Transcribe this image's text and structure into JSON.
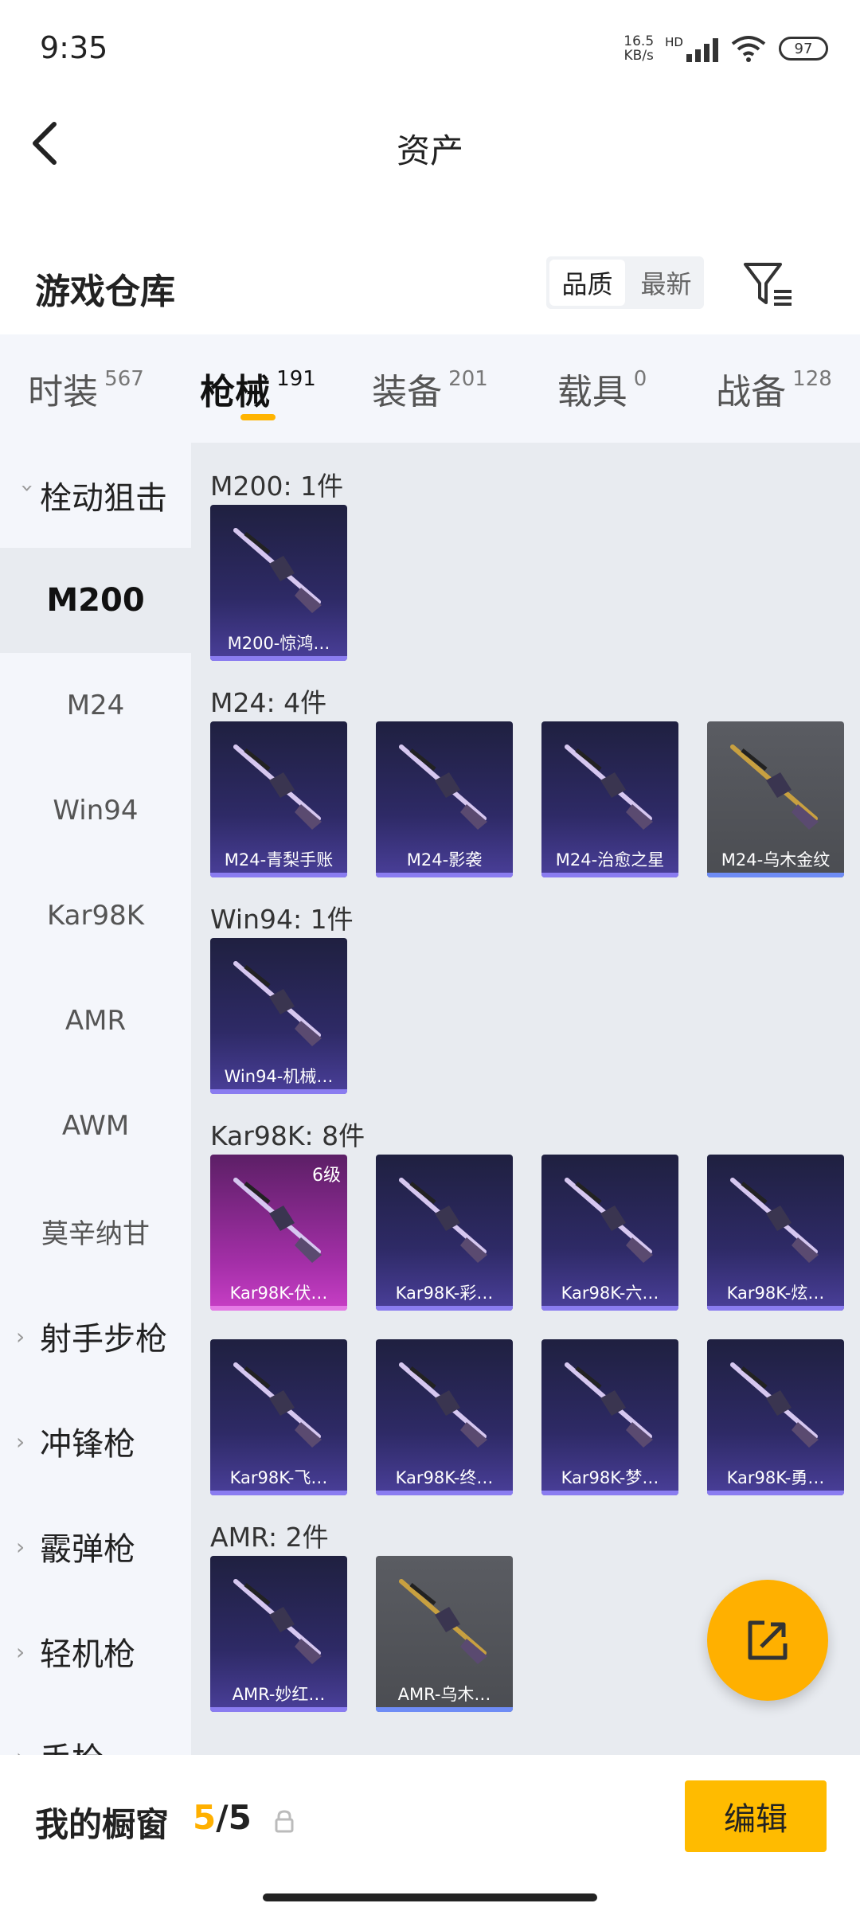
{
  "status_bar": {
    "time": "9:35",
    "speed_value": "16.5",
    "speed_unit": "KB/s",
    "hd": "HD",
    "battery": "97"
  },
  "header": {
    "title": "资产"
  },
  "warehouse": {
    "title": "游戏仓库",
    "sort_options": [
      "品质",
      "最新"
    ],
    "sort_active": "品质"
  },
  "tabs": [
    {
      "label": "时装",
      "count": "567"
    },
    {
      "label": "枪械",
      "count": "191",
      "active": true
    },
    {
      "label": "装备",
      "count": "201"
    },
    {
      "label": "载具",
      "count": "0"
    },
    {
      "label": "战备",
      "count": "128"
    }
  ],
  "sidebar": {
    "open_group": "栓动狙击",
    "items": [
      "M200",
      "M24",
      "Win94",
      "Kar98K",
      "AMR",
      "AWM",
      "莫辛纳甘"
    ],
    "active_item": "M200",
    "groups": [
      "射手步枪",
      "冲锋枪",
      "霰弹枪",
      "轻机枪",
      "手枪"
    ]
  },
  "sections": [
    {
      "title": "M200: 1件",
      "items": [
        {
          "name": "M200-惊鸿…",
          "style": "purple"
        }
      ]
    },
    {
      "title": "M24: 4件",
      "items": [
        {
          "name": "M24-青梨手账",
          "style": "purple"
        },
        {
          "name": "M24-影袭",
          "style": "purple"
        },
        {
          "name": "M24-治愈之星",
          "style": "purple"
        },
        {
          "name": "M24-乌木金纹",
          "style": "grey"
        }
      ]
    },
    {
      "title": "Win94: 1件",
      "items": [
        {
          "name": "Win94-机械…",
          "style": "purple"
        }
      ]
    },
    {
      "title": "Kar98K: 8件",
      "items": [
        {
          "name": "Kar98K-伏…",
          "style": "pink",
          "level": "6级"
        },
        {
          "name": "Kar98K-彩…",
          "style": "purple"
        },
        {
          "name": "Kar98K-六…",
          "style": "purple"
        },
        {
          "name": "Kar98K-炫…",
          "style": "purple"
        },
        {
          "name": "Kar98K-飞…",
          "style": "purple"
        },
        {
          "name": "Kar98K-终…",
          "style": "purple"
        },
        {
          "name": "Kar98K-梦…",
          "style": "purple"
        },
        {
          "name": "Kar98K-勇…",
          "style": "purple"
        }
      ]
    },
    {
      "title": "AMR: 2件",
      "items": [
        {
          "name": "AMR-妙红…",
          "style": "purple"
        },
        {
          "name": "AMR-乌木…",
          "style": "grey"
        }
      ]
    }
  ],
  "bottom_bar": {
    "title": "我的橱窗",
    "current": "5",
    "separator": "/",
    "total": "5",
    "edit_label": "编辑"
  },
  "icons": {
    "back": "chevron-left-icon",
    "filter": "filter-icon",
    "share": "share-icon",
    "lock": "lock-icon"
  },
  "colors": {
    "accent": "#ffb000",
    "card_purple": "#2e2a66",
    "card_grey": "#4b4d52",
    "card_pink": "#a42fa8"
  }
}
